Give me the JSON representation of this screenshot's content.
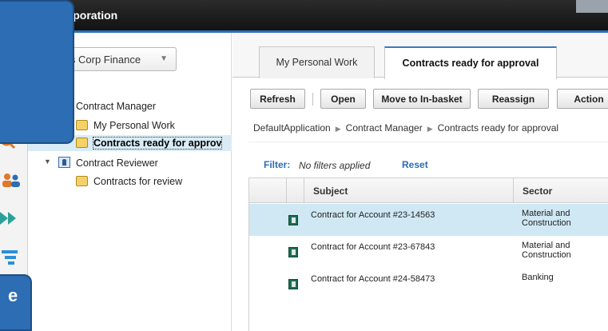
{
  "window": {
    "title": "Focus Corporation"
  },
  "colors": {
    "accent": "#2a6fb8",
    "selected_row": "#cfe8f4",
    "link": "#2a6db3",
    "callout": "#2c6db3"
  },
  "nav": {
    "solution_dropdown": {
      "value": "Focus Corp Finance",
      "icon": "chevron-down-icon"
    },
    "tree": [
      {
        "label": "Contract Manager",
        "icon": "role-icon",
        "expanded": true,
        "children": [
          {
            "label": "My Personal Work",
            "icon": "inbox-icon",
            "selected": false
          },
          {
            "label": "Contracts ready for approv",
            "icon": "inbox-icon",
            "selected": true
          }
        ]
      },
      {
        "label": "Contract Reviewer",
        "icon": "role-icon",
        "expanded": true,
        "children": [
          {
            "label": "Contracts for review",
            "icon": "inbox-icon",
            "selected": false
          }
        ]
      }
    ]
  },
  "callout_lower": {
    "text": "e"
  },
  "main": {
    "tabs": [
      {
        "label": "My Personal Work",
        "active": false
      },
      {
        "label": "Contracts ready for approval",
        "active": true
      }
    ],
    "toolbar": {
      "refresh": "Refresh",
      "open": "Open",
      "move": "Move to In-basket",
      "reassign": "Reassign",
      "actions": "Action"
    },
    "breadcrumb": [
      "DefaultApplication",
      "Contract Manager",
      "Contracts ready for approval"
    ],
    "filter": {
      "label": "Filter:",
      "value": "No filters applied",
      "reset": "Reset"
    },
    "grid": {
      "columns": [
        "Subject",
        "Sector"
      ],
      "rows": [
        {
          "subject": "Contract for Account #23-14563",
          "sector": "Material and Construction",
          "selected": true
        },
        {
          "subject": "Contract for Account #23-67843",
          "sector": "Material and Construction",
          "selected": false
        },
        {
          "subject": "Contract for Account #24-58473",
          "sector": "Banking",
          "selected": false
        }
      ]
    }
  }
}
